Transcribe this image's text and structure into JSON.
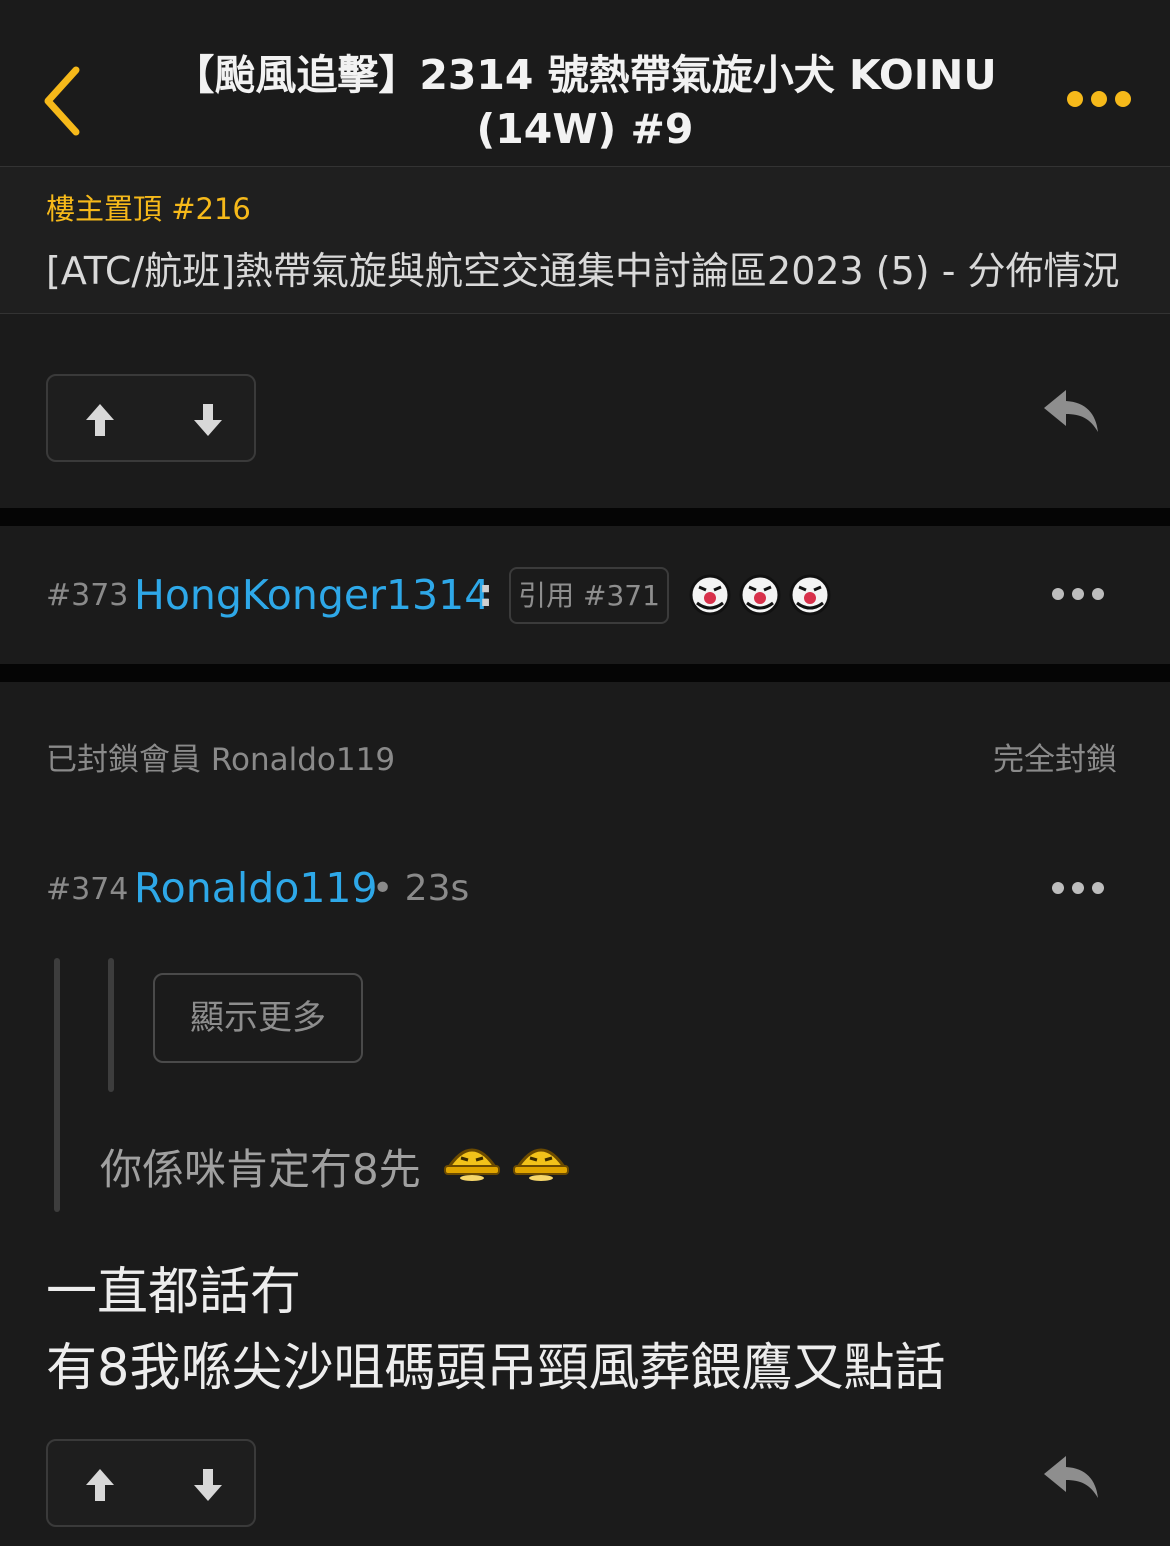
{
  "colors": {
    "accent": "#f6b91a",
    "username": "#2ea8e8",
    "background": "#1b1b1b"
  },
  "header": {
    "back_icon": "chevron-left-icon",
    "title_line1": "【颱風追擊】2314 號熱帶氣旋小犬 KOINU",
    "title_line2": "(14W) #9",
    "more_icon": "more-horizontal-icon"
  },
  "pinned": {
    "label": "樓主置頂 #216",
    "title": "[ATC/航班]熱帶氣旋與航空交通集中討論區2023 (5) - 分佈情況"
  },
  "post373": {
    "number": "#373",
    "username": "HongKonger1314",
    "colon": ":",
    "quote_label": "引用 #371",
    "emoji_icon": "clown-face-icon"
  },
  "blocked": {
    "text": "已封鎖會員 Ronaldo119",
    "action": "完全封鎖"
  },
  "post374": {
    "number": "#374",
    "username": "Ronaldo119",
    "time": "• 23s",
    "show_more": "顯示更多",
    "quoted_text": "你係咪肯定冇8先",
    "emoji_icon": "sweat-face-icon",
    "body_line1": "一直都話冇",
    "body_line2": "有8我喺尖沙咀碼頭吊頸風葬餵鷹又點話"
  },
  "icons": {
    "upvote": "arrow-up-icon",
    "downvote": "arrow-down-icon",
    "reply": "reply-icon",
    "more": "more-horizontal-icon"
  }
}
